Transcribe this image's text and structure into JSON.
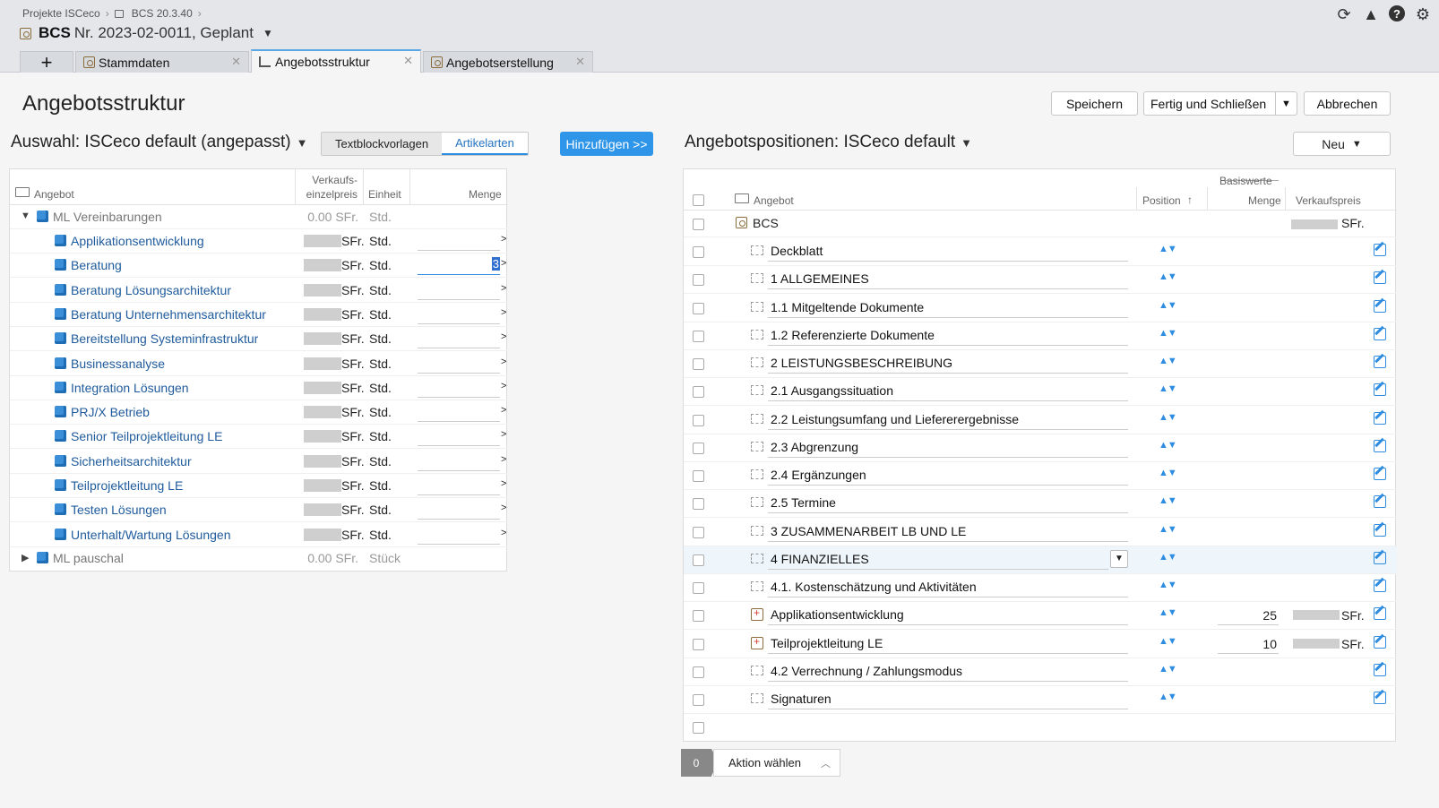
{
  "header": {
    "breadcrumb": [
      "Projekte ISCeco",
      "BCS 20.3.40"
    ],
    "title_bold": "BCS",
    "title_rest": "Nr. 2023-02-0011, Geplant"
  },
  "tabs": [
    {
      "label": "Stammdaten"
    },
    {
      "label": "Angebotsstruktur"
    },
    {
      "label": "Angebotserstellung"
    }
  ],
  "page": {
    "title": "Angebotsstruktur",
    "buttons": {
      "save": "Speichern",
      "finish": "Fertig und Schließen",
      "cancel": "Abbrechen"
    }
  },
  "left": {
    "selection_title": "Auswahl: ISCeco default (angepasst)",
    "segments": {
      "textblocks": "Textblockvorlagen",
      "articles": "Artikelarten"
    },
    "add_button": "Hinzufügen >>",
    "columns": {
      "angebot": "Angebot",
      "price_1": "Verkaufs-",
      "price_2": "einzelpreis",
      "unit": "Einheit",
      "qty": "Menge"
    },
    "groups": [
      {
        "label": "ML Vereinbarungen",
        "price": "0.00 SFr.",
        "unit": "Std."
      },
      {
        "label": "ML pauschal",
        "price": "0.00 SFr.",
        "unit": "Stück"
      }
    ],
    "currency": "SFr.",
    "unit": "Std.",
    "arrow": ">",
    "active_qty": "3",
    "items": [
      "Applikationsentwicklung",
      "Beratung",
      "Beratung Lösungsarchitektur",
      "Beratung Unternehmensarchitektur",
      "Bereitstellung Systeminfrastruktur",
      "Businessanalyse",
      "Integration Lösungen",
      "PRJ/X Betrieb",
      "Senior Teilprojektleitung LE",
      "Sicherheitsarchitektur",
      "Teilprojektleitung LE",
      "Testen Lösungen",
      "Unterhalt/Wartung Lösungen"
    ]
  },
  "right": {
    "title": "Angebotspositionen: ISCeco default",
    "new_button": "Neu",
    "columns": {
      "angebot": "Angebot",
      "position": "Position",
      "basiswerte": "Basiswerte",
      "menge": "Menge",
      "verkaufspreis": "Verkaufspreis"
    },
    "root": {
      "label": "BCS",
      "currency": "SFr."
    },
    "rows": [
      {
        "label": "Deckblatt"
      },
      {
        "label": "1 ALLGEMEINES"
      },
      {
        "label": "1.1 Mitgeltende Dokumente"
      },
      {
        "label": "1.2 Referenzierte Dokumente"
      },
      {
        "label": "2 LEISTUNGSBESCHREIBUNG"
      },
      {
        "label": "2.1 Ausgangssituation"
      },
      {
        "label": "2.2 Leistungsumfang und Liefererergebnisse"
      },
      {
        "label": "2.3 Abgrenzung"
      },
      {
        "label": "2.4 Ergänzungen"
      },
      {
        "label": "2.5 Termine"
      },
      {
        "label": "3 ZUSAMMENARBEIT LB UND LE"
      },
      {
        "label": "4 FINANZIELLES"
      },
      {
        "label": "4.1. Kostenschätzung und Aktivitäten"
      },
      {
        "label": "Applikationsentwicklung",
        "menge": "25",
        "currency": "SFr."
      },
      {
        "label": "Teilprojektleitung LE",
        "menge": "10",
        "currency": "SFr."
      },
      {
        "label": "4.2 Verrechnung / Zahlungsmodus"
      },
      {
        "label": "Signaturen"
      }
    ]
  },
  "actionbar": {
    "count": "0",
    "label": "Aktion wählen"
  }
}
